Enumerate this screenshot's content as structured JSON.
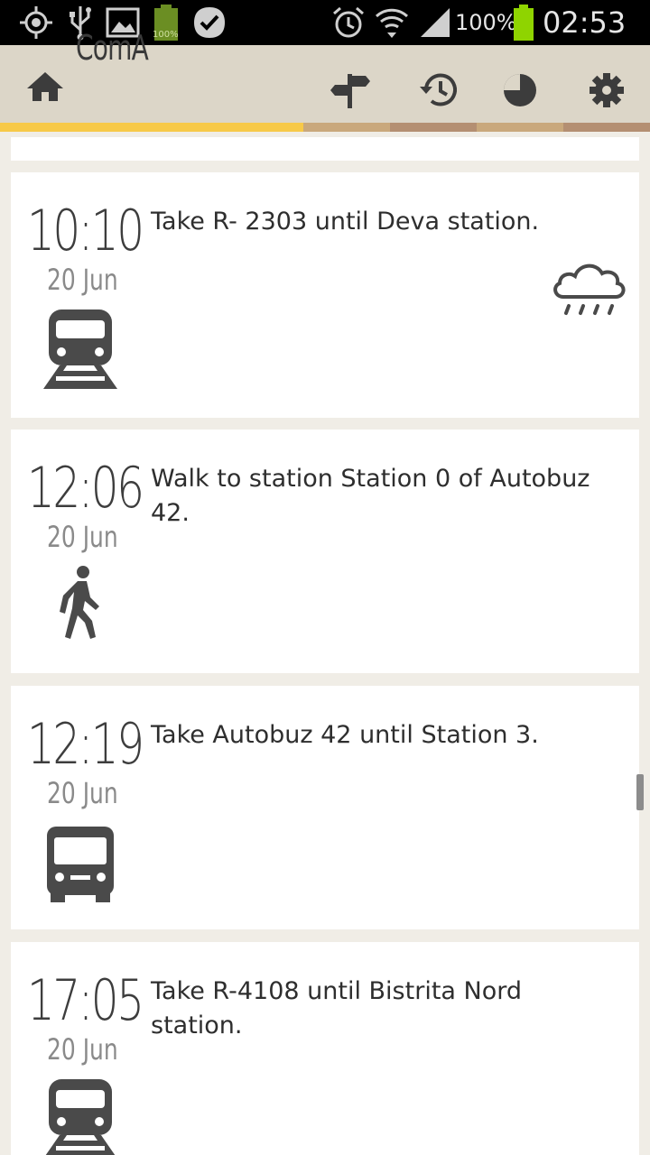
{
  "status_bar": {
    "battery_percent": "100%",
    "mini_battery_label": "100%",
    "clock": "02:53",
    "icons": [
      "gps-icon",
      "usb-icon",
      "image-icon",
      "battery-charging-icon",
      "check-badge-icon",
      "alarm-icon",
      "wifi-icon",
      "signal-icon",
      "battery-icon"
    ]
  },
  "action_bar": {
    "title": "ComA",
    "icons": [
      "home-icon",
      "signpost-icon",
      "history-icon",
      "pie-chart-icon",
      "settings-icon"
    ],
    "tab_colors": [
      "#f7c948",
      "#c9a87c",
      "#b48f72",
      "#c9a87c",
      "#b48f72"
    ]
  },
  "steps": [
    {
      "time": "10:10",
      "date": "20 Jun",
      "instruction": "Take R- 2303 until Deva station.",
      "mode_icon": "train-icon",
      "weather_icon": "rain-cloud-icon"
    },
    {
      "time": "12:06",
      "date": "20 Jun",
      "instruction": "Walk to station Station 0 of Autobuz 42.",
      "mode_icon": "walk-icon"
    },
    {
      "time": "12:19",
      "date": "20 Jun",
      "instruction": "Take Autobuz 42 until Station 3.",
      "mode_icon": "bus-icon"
    },
    {
      "time": "17:05",
      "date": "20 Jun",
      "instruction": "Take R-4108 until Bistrita Nord station.",
      "mode_icon": "train-icon"
    }
  ],
  "colors": {
    "accent": "#f7c948",
    "icon": "#4a4a4a",
    "background": "#f0ede6"
  }
}
